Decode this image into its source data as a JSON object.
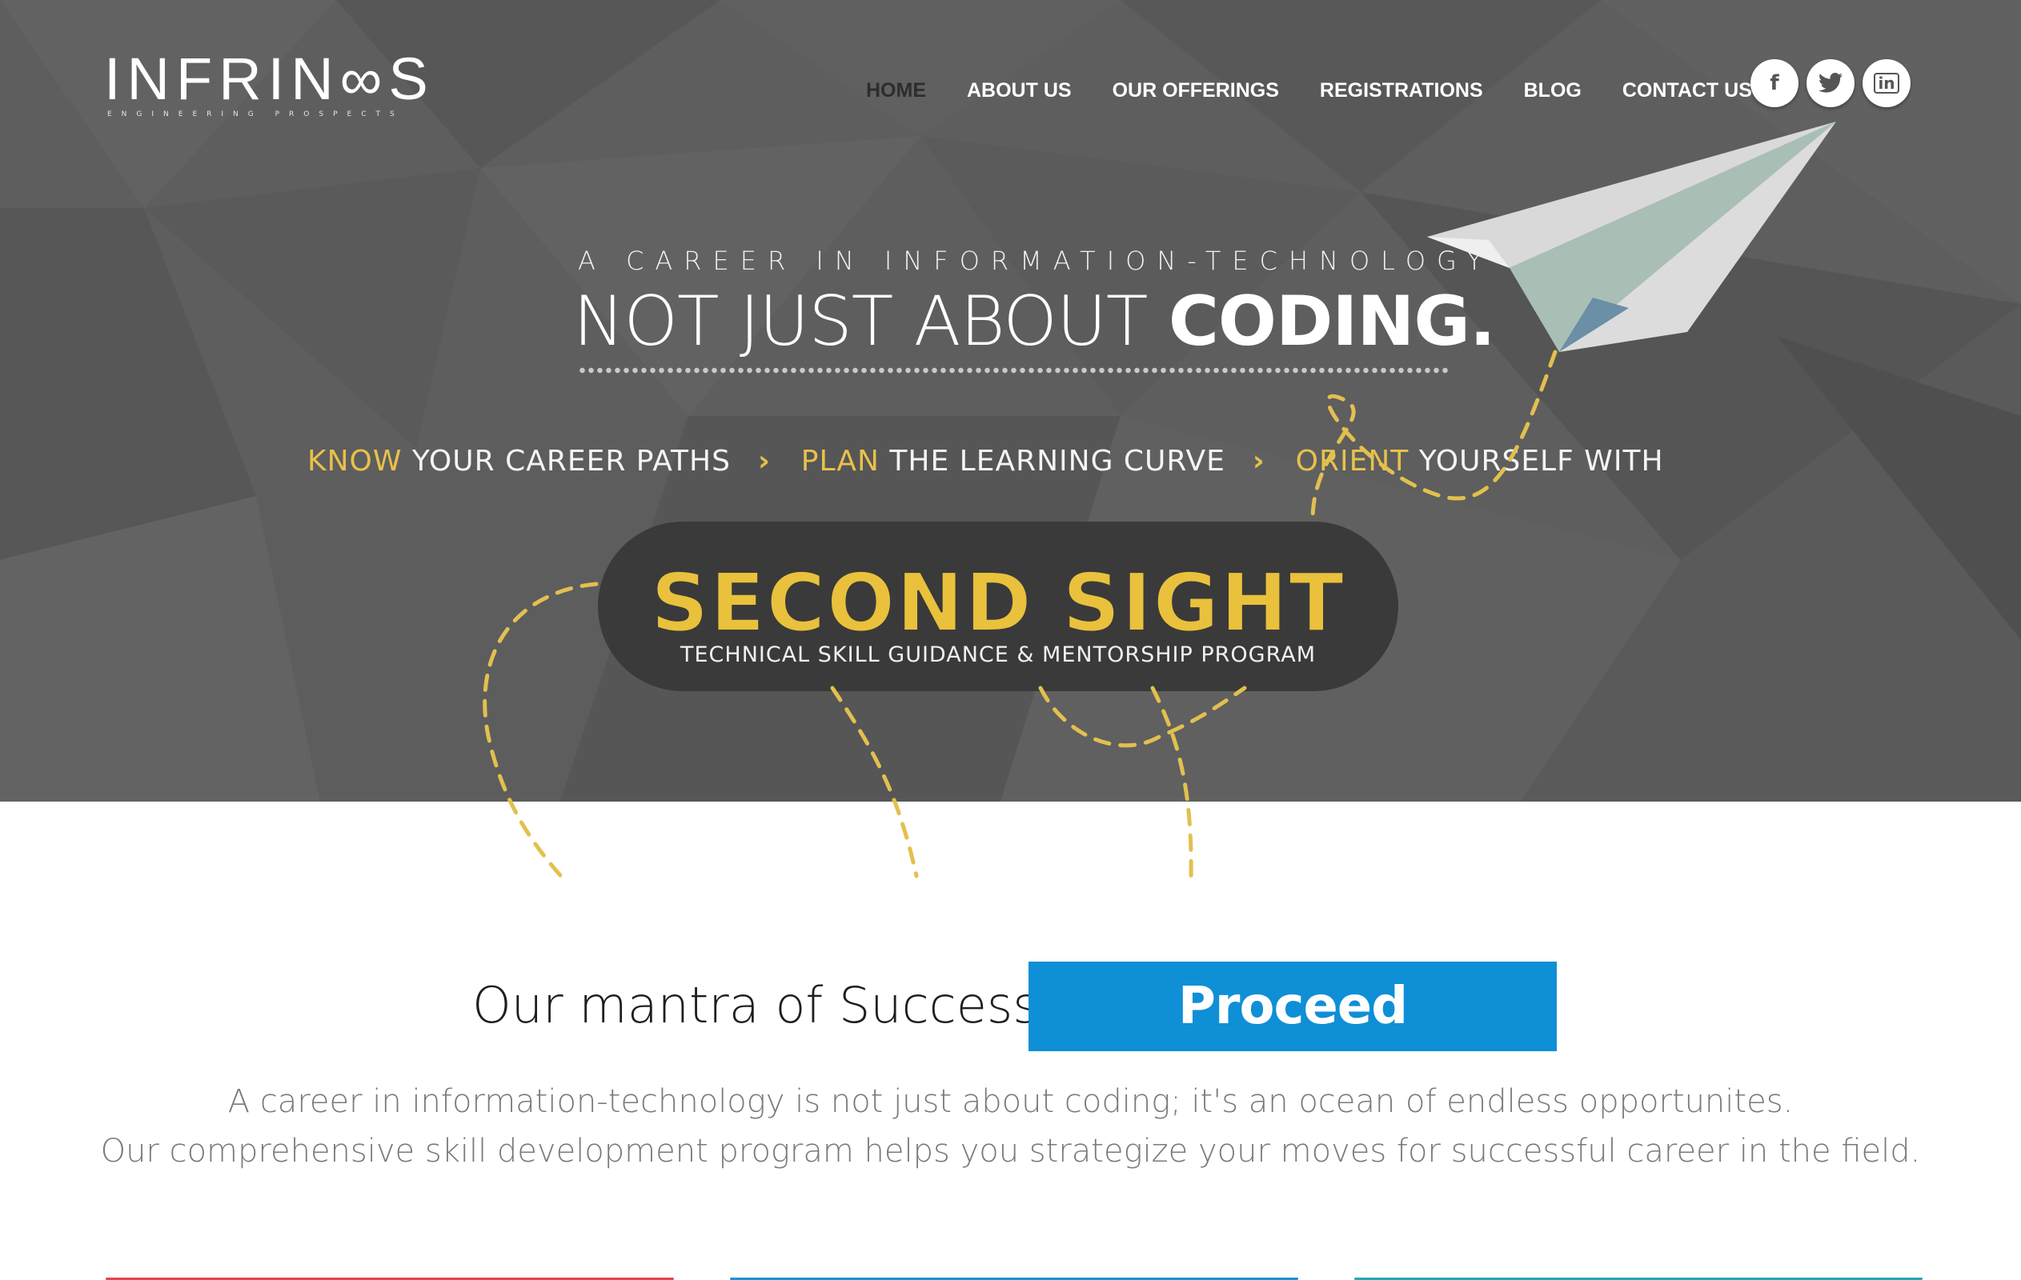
{
  "brand": {
    "logo_text": "INFRIN∞S",
    "tagline": "ENGINEERING PROSPECTS"
  },
  "nav": {
    "items": [
      {
        "label": "HOME",
        "active": true
      },
      {
        "label": "ABOUT US",
        "active": false
      },
      {
        "label": "OUR OFFERINGS",
        "active": false
      },
      {
        "label": "REGISTRATIONS",
        "active": false
      },
      {
        "label": "BLOG",
        "active": false
      },
      {
        "label": "CONTACT US",
        "active": false
      }
    ],
    "social": [
      {
        "icon": "facebook-icon",
        "glyph": "f"
      },
      {
        "icon": "twitter-icon",
        "glyph": "🐦"
      },
      {
        "icon": "linkedin-icon",
        "glyph": "in"
      }
    ]
  },
  "hero": {
    "kicker": "A CAREER IN INFORMATION-TECHNOLOGY IS",
    "headline_light": "NOT JUST ABOUT ",
    "headline_bold": "CODING.",
    "steps": [
      {
        "highlight": "KNOW",
        "rest": " YOUR CAREER PATHS"
      },
      {
        "highlight": "PLAN",
        "rest": " THE LEARNING CURVE"
      },
      {
        "highlight": "ORIENT",
        "rest": " YOURSELF WITH"
      }
    ],
    "step_separator": "›",
    "badge_title": "SECOND SIGHT",
    "badge_subtitle": "TECHNICAL SKILL GUIDANCE & MENTORSHIP PROGRAM"
  },
  "mantra": {
    "label": "Our mantra of Success :",
    "highlight": "Proceed Positively.",
    "line1": "A career in information-technology is not just about coding; it's an ocean of endless opportunites.",
    "line2": "Our comprehensive skill development program helps you strategize your moves for successful career in the field."
  },
  "colors": {
    "hero_bg": "#5c5c5c",
    "accent_yellow": "#e8c14a",
    "accent_blue": "#0f8fd6",
    "card_red": "#e0474c",
    "card_blue": "#1f8fd3",
    "card_teal": "#22a7b5"
  }
}
